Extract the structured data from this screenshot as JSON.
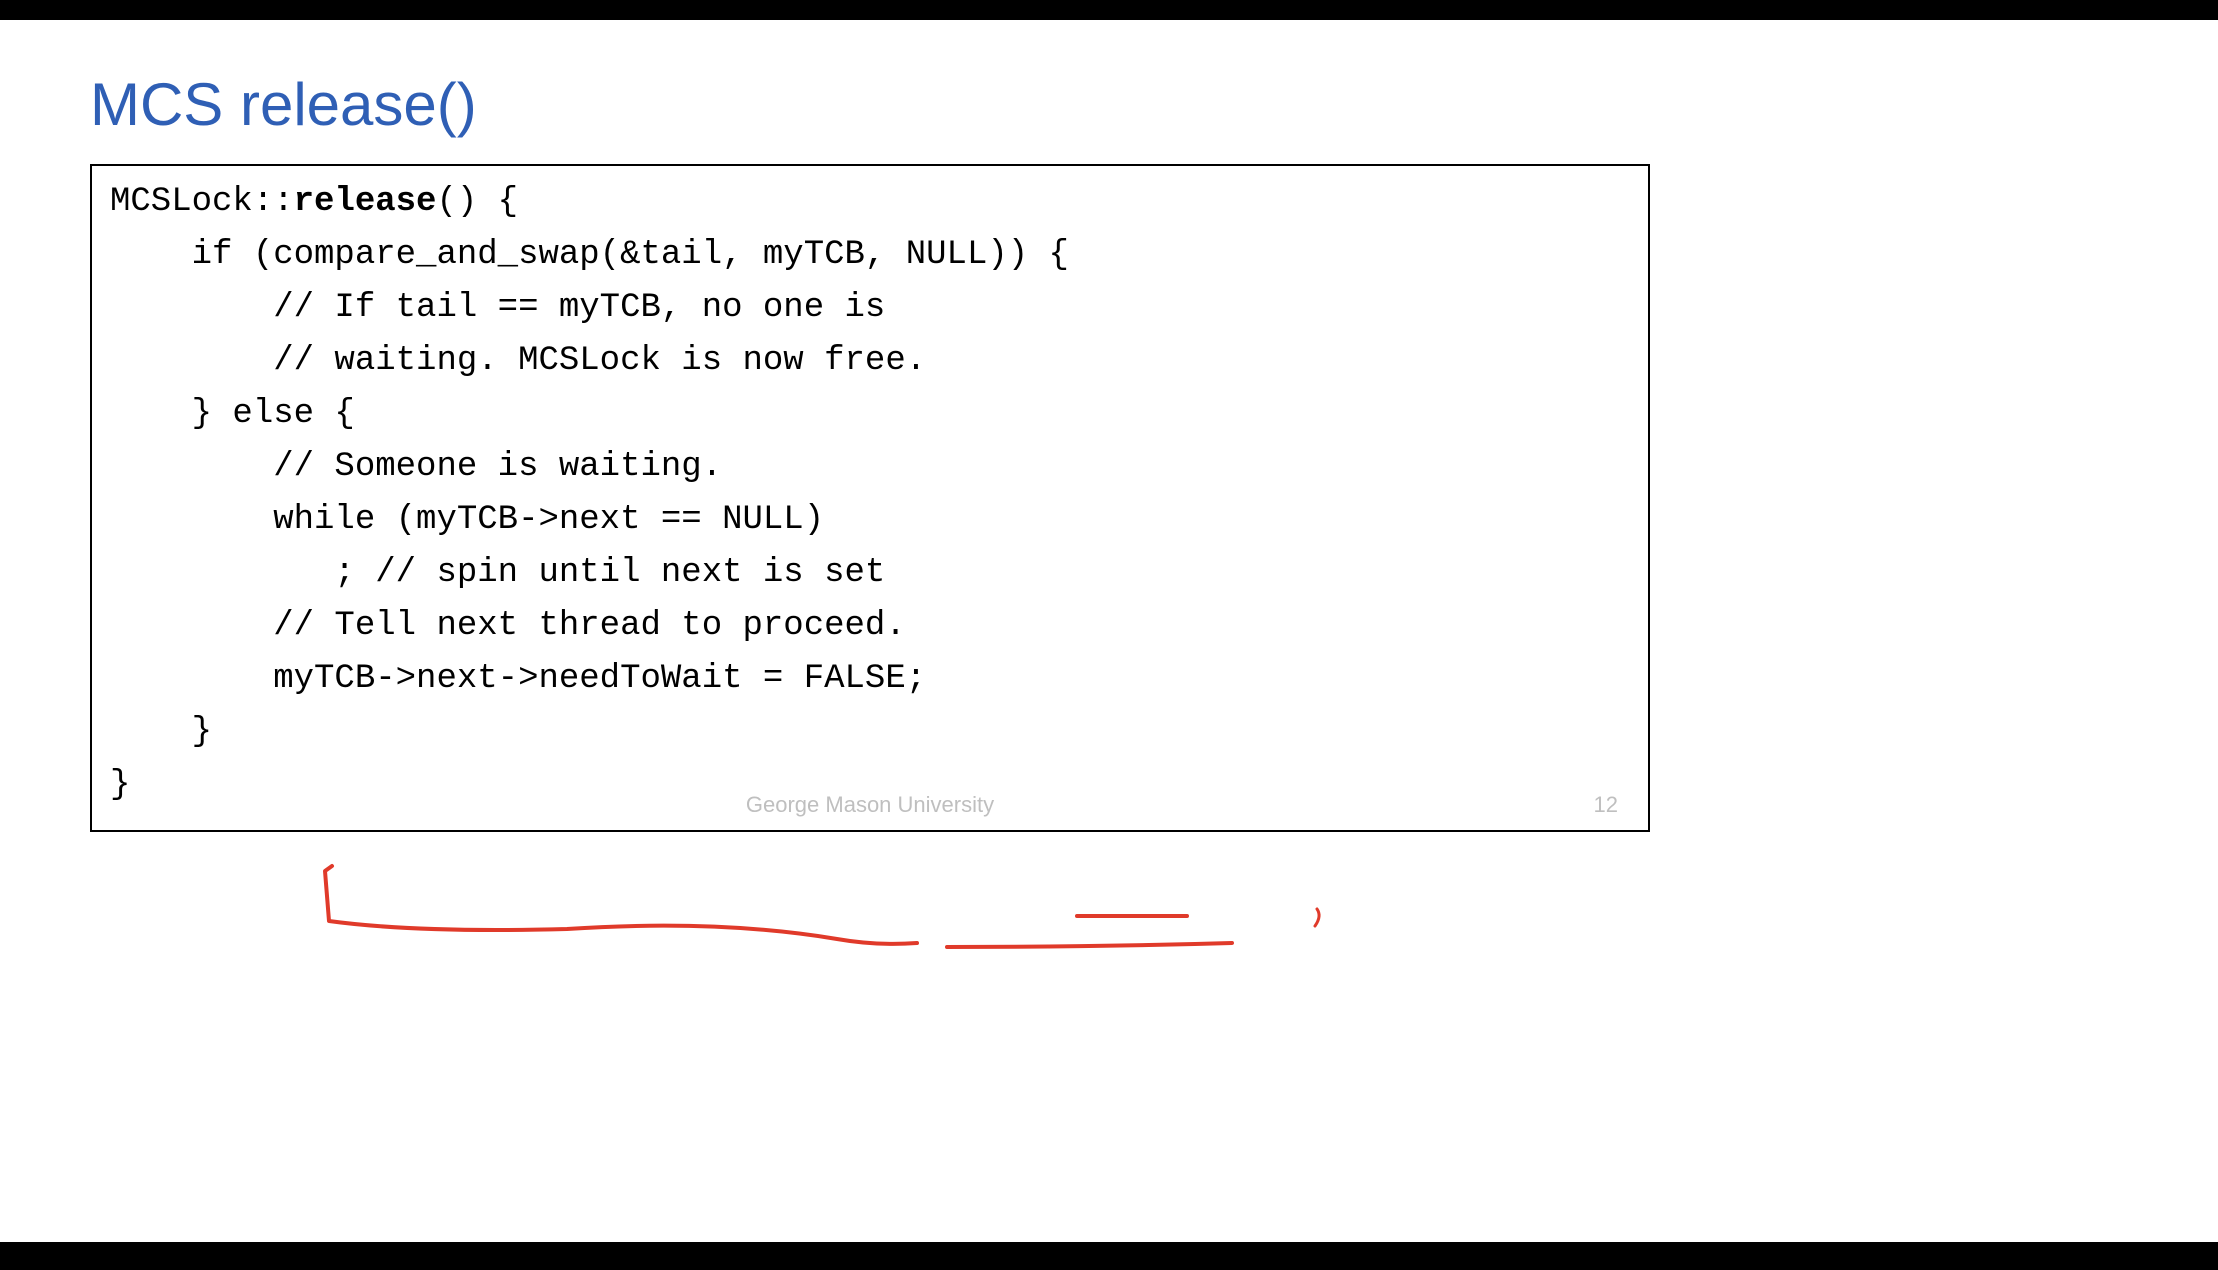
{
  "slide": {
    "title": "MCS release()",
    "code": {
      "line1_prefix": "MCSLock::",
      "line1_bold": "release",
      "line1_suffix": "() {",
      "line2": "    if (compare_and_swap(&tail, myTCB, NULL)) {",
      "line3": "        // If tail == myTCB, no one is",
      "line4": "        // waiting. MCSLock is now free.",
      "line5": "    } else {",
      "line6": "        // Someone is waiting.",
      "line7": "        while (myTCB->next == NULL)",
      "line8": "           ; // spin until next is set",
      "line9": "        // Tell next thread to proceed.",
      "line10": "        myTCB->next->needToWait = FALSE;",
      "line11": "    }",
      "line12": "}"
    },
    "footer_center": "George Mason University",
    "slide_number": "12",
    "annotation_color": "#e03a2a"
  }
}
